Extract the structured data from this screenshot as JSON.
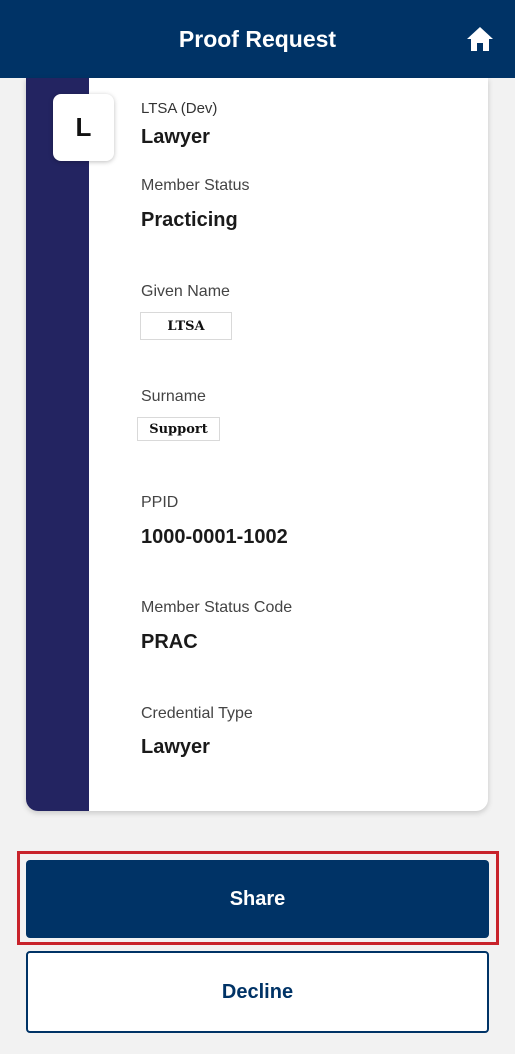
{
  "header": {
    "title": "Proof Request",
    "home_icon": "home-icon"
  },
  "card": {
    "logo_letter": "L",
    "issuer": "LTSA (Dev)",
    "name": "Lawyer",
    "stripe_color": "#232461"
  },
  "attributes": [
    {
      "label": "Member Status",
      "value": "Practicing"
    },
    {
      "label": "Given Name",
      "value": "LTSA"
    },
    {
      "label": "Surname",
      "value": "Support"
    },
    {
      "label": "PPID",
      "value": "1000-0001-1002"
    },
    {
      "label": "Member Status Code",
      "value": "PRAC"
    },
    {
      "label": "Credential Type",
      "value": "Lawyer"
    }
  ],
  "actions": {
    "share_label": "Share",
    "decline_label": "Decline"
  },
  "colors": {
    "primary": "#003366",
    "highlight": "#c8232b"
  }
}
